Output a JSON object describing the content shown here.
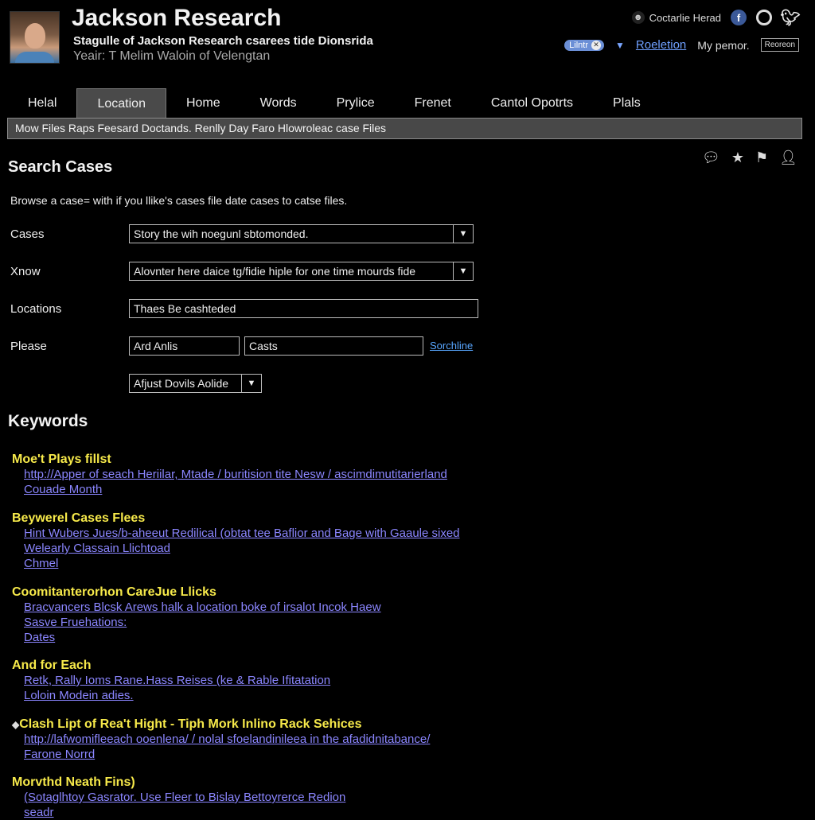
{
  "header": {
    "title": "Jackson Research",
    "subtitle": "Stagulle of Jackson Research csarees tide Dionsrida",
    "tagline": "Yeair: T Melim Waloin of Velengtan",
    "user_name": "Coctarlie Herad",
    "pill_label": "Lilntr",
    "link": "Roeletion",
    "menu": "My pemor.",
    "button": "Reoreon"
  },
  "tabs": [
    {
      "label": "Helal"
    },
    {
      "label": "Location",
      "active": true
    },
    {
      "label": "Home"
    },
    {
      "label": "Words"
    },
    {
      "label": "Prylice"
    },
    {
      "label": "Frenet"
    },
    {
      "label": "Cantol Opotrts"
    },
    {
      "label": "Plals"
    }
  ],
  "notice": "Mow Files Raps Feesard Doctands. Renlly Day Faro Hlowroleac case Files",
  "search": {
    "title": "Search Cases",
    "description": "Browse a case= with if you llike's cases file date cases to catse files.",
    "fields": [
      {
        "label": "Cases",
        "value": "Story the wih noegunl sbtomonded."
      },
      {
        "label": "Xnow",
        "value": "Alovnter here daice tg/fidie hiple for one time mourds fide"
      },
      {
        "label": "Locations",
        "value": "Thaes Be cashteded"
      },
      {
        "label": "Please",
        "value": "Ard Anlis"
      },
      {
        "label": "",
        "value": "Casts"
      },
      {
        "label": "",
        "value": "Afjust  Dovils Aolide"
      }
    ],
    "search_link": "Sorchline"
  },
  "keywords": {
    "title": "Keywords",
    "groups": [
      {
        "heading": "Moe't Plays fillst",
        "links": [
          "http://Apper of seach Heriilar, Mtade / buritision tite Nesw / ascimdimutitarierland",
          "Couade Month"
        ]
      },
      {
        "heading": "Beywerel Cases Flees",
        "links": [
          "Hint Wubers Jues/b-aheeut Redilical (obtat tee Baflior and Bage with Gaaule sixed",
          "Welearly Classain Llichtoad",
          "Chmel"
        ]
      },
      {
        "heading": "Coomitanterorhon CareJue Llicks",
        "links": [
          "Bracvancers Blcsk Arews halk a location boke of irsalot Incok Haew",
          "Sasve Fruehations:",
          "Dates"
        ]
      },
      {
        "heading": "And for Each",
        "links": [
          "Retk, Rally Ioms Rane.Hass Reises (ke & Rable Ifitatation",
          "Loloin Modein adies."
        ]
      },
      {
        "heading": "Clash Lipt of Rea't Hight - Tiph Mork Inlino Rack Sehices",
        "links": [
          "http://lafwomifleeach ooenlena/ / nolal sfoelandinileea in the afadidnitabance/",
          "Farone Norrd"
        ]
      },
      {
        "heading": "Morvthd Neath Fins)",
        "links": [
          "(Sotaglhtoy Gasrator. Use Fleer to Bislay Bettoyrerce Redion",
          "seadr"
        ]
      }
    ]
  },
  "icons": {
    "facebook": "facebook-icon",
    "circle": "circle-icon",
    "twitter": "twitter-icon",
    "tools": [
      "comment-icon",
      "star-icon",
      "flag-icon",
      "user-icon"
    ]
  },
  "colors": {
    "background": "#000000",
    "heading_yellow": "#f6e94a",
    "link_purple": "#8b86ff",
    "link_blue": "#6fa0ff",
    "active_tab": "#4a4a4a"
  }
}
